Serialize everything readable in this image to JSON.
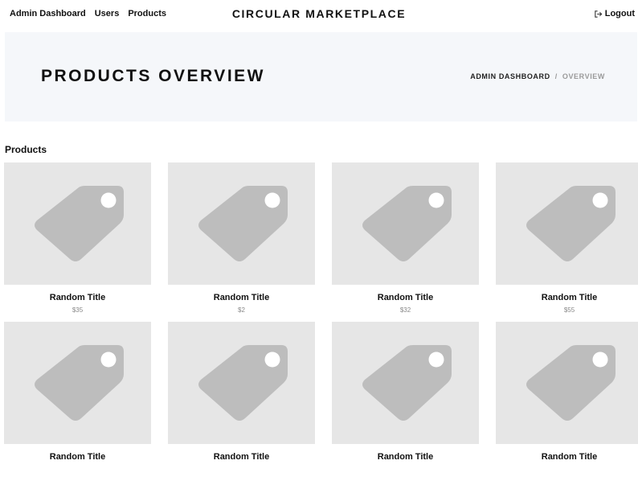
{
  "nav": {
    "links": [
      "Admin Dashboard",
      "Users",
      "Products"
    ],
    "brand": "CIRCULAR MARKETPLACE",
    "logout_label": "Logout"
  },
  "hero": {
    "title": "PRODUCTS OVERVIEW",
    "breadcrumb": {
      "parent": "ADMIN DASHBOARD",
      "separator": "/",
      "current": "OVERVIEW"
    }
  },
  "section": {
    "title": "Products"
  },
  "products": [
    {
      "title": "Random Title",
      "price": "$35",
      "icon": "price-tag-icon"
    },
    {
      "title": "Random Title",
      "price": "$2",
      "icon": "price-tag-icon"
    },
    {
      "title": "Random Title",
      "price": "$32",
      "icon": "price-tag-icon"
    },
    {
      "title": "Random Title",
      "price": "$55",
      "icon": "price-tag-icon"
    },
    {
      "title": "Random Title",
      "price": "",
      "icon": "price-tag-icon"
    },
    {
      "title": "Random Title",
      "price": "",
      "icon": "price-tag-icon"
    },
    {
      "title": "Random Title",
      "price": "",
      "icon": "price-tag-icon"
    },
    {
      "title": "Random Title",
      "price": "",
      "icon": "price-tag-icon"
    }
  ],
  "colors": {
    "hero_bg": "#f5f7fa",
    "thumb_bg": "#e6e6e6",
    "tag_icon": "#bdbdbd",
    "muted_text": "#888888"
  }
}
